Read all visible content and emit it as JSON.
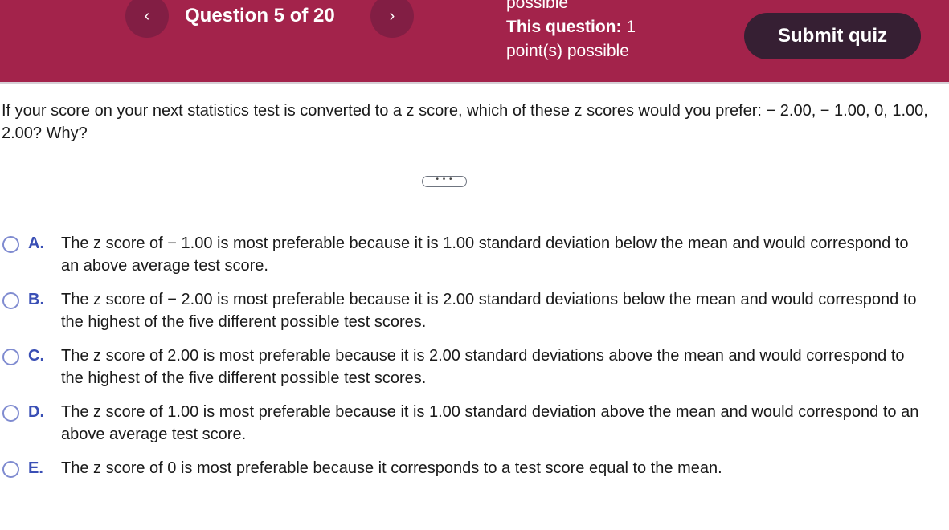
{
  "header": {
    "prev_icon": "chevron-left-icon",
    "next_icon": "chevron-right-icon",
    "prev": "‹",
    "next": "›",
    "title": "Question 5 of 20",
    "points_prev_tail": "possible",
    "points_label": "This question:",
    "points_value": "1",
    "points_suffix": "point(s) possible",
    "submit": "Submit quiz",
    "colors": {
      "header": "#A3234B",
      "submit": "#361F33"
    }
  },
  "question": {
    "text": "If your score on your next statistics test is converted to a z score, which of these z scores would you prefer: − 2.00, − 1.00, 0, 1.00, 2.00? Why?",
    "more": "• • •"
  },
  "options": [
    {
      "letter": "A.",
      "text": "The z score of  − 1.00 is most preferable because it is 1.00 standard deviation below the mean and would correspond to an above average test score."
    },
    {
      "letter": "B.",
      "text": "The z score of  − 2.00 is most preferable because it is 2.00 standard deviations below the mean and would correspond to the highest of the five different possible test scores."
    },
    {
      "letter": "C.",
      "text": "The z score of 2.00 is most preferable because it is 2.00 standard deviations above the mean and would correspond to the highest of the five different possible test scores."
    },
    {
      "letter": "D.",
      "text": "The z score of 1.00 is most preferable because it is 1.00 standard deviation above the mean and would correspond to an above average test score."
    },
    {
      "letter": "E.",
      "text": "The z score of 0 is most preferable because it corresponds to a test score equal to the mean."
    }
  ]
}
